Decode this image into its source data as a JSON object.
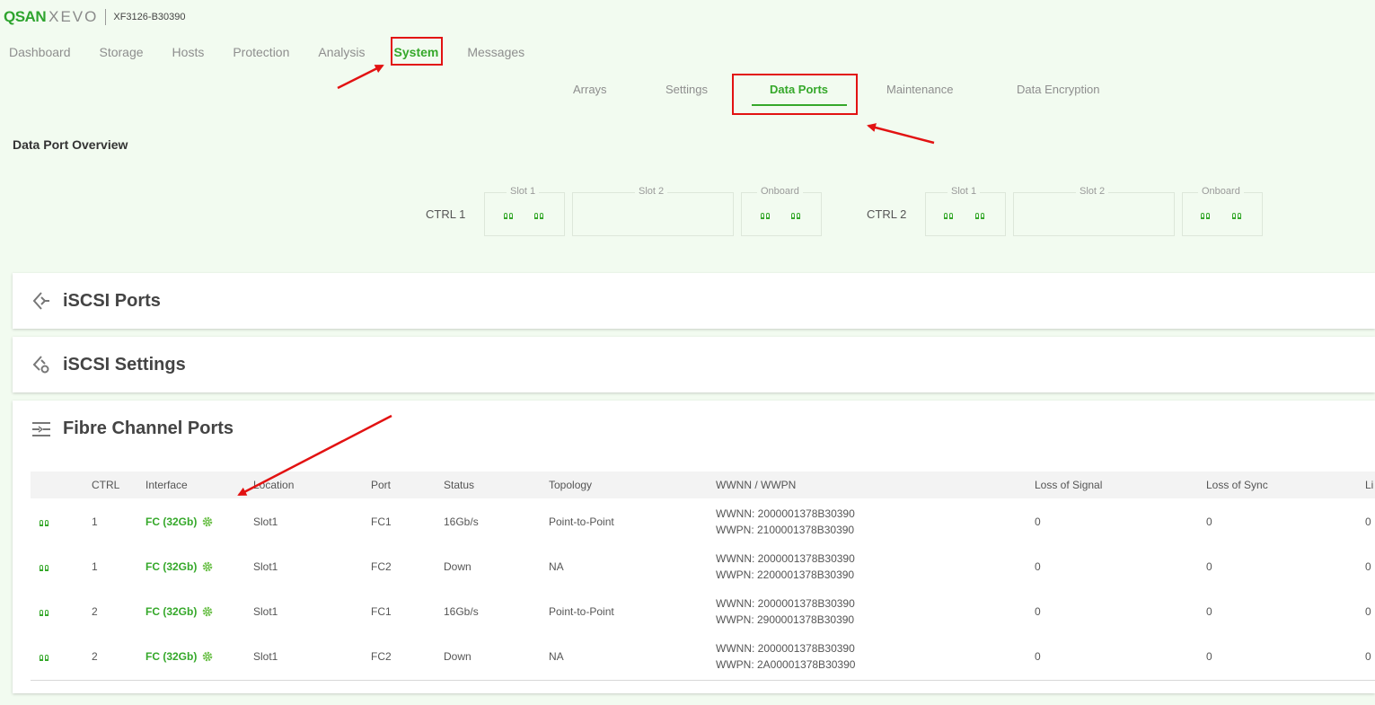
{
  "brand": {
    "logo_a": "QSAN",
    "logo_b": "XEVO",
    "model": "XF3126-B30390"
  },
  "topnav": [
    "Dashboard",
    "Storage",
    "Hosts",
    "Protection",
    "Analysis",
    "System",
    "Messages"
  ],
  "subnav": [
    "Arrays",
    "Settings",
    "Data Ports",
    "Maintenance",
    "Data Encryption"
  ],
  "overview": {
    "title": "Data Port Overview",
    "ctrl1": "CTRL 1",
    "ctrl2": "CTRL 2",
    "slot1": "Slot 1",
    "slot2": "Slot 2",
    "onboard": "Onboard"
  },
  "panels": {
    "iscsi_ports": "iSCSI Ports",
    "iscsi_settings": "iSCSI Settings",
    "fc_ports": "Fibre Channel Ports"
  },
  "table": {
    "headers": [
      "CTRL",
      "Interface",
      "Location",
      "Port",
      "Status",
      "Topology",
      "WWNN / WWPN",
      "Loss of Signal",
      "Loss of Sync",
      "Li"
    ],
    "rows": [
      {
        "ctrl": "1",
        "iface": "FC (32Gb)",
        "loc": "Slot1",
        "port": "FC1",
        "status": "16Gb/s",
        "topo": "Point-to-Point",
        "wwnn": "WWNN: 2000001378B30390",
        "wwpn": "WWPN: 2100001378B30390",
        "los": "0",
        "lsync": "0",
        "li": "0"
      },
      {
        "ctrl": "1",
        "iface": "FC (32Gb)",
        "loc": "Slot1",
        "port": "FC2",
        "status": "Down",
        "topo": "NA",
        "wwnn": "WWNN: 2000001378B30390",
        "wwpn": "WWPN: 2200001378B30390",
        "los": "0",
        "lsync": "0",
        "li": "0"
      },
      {
        "ctrl": "2",
        "iface": "FC (32Gb)",
        "loc": "Slot1",
        "port": "FC1",
        "status": "16Gb/s",
        "topo": "Point-to-Point",
        "wwnn": "WWNN: 2000001378B30390",
        "wwpn": "WWPN: 2900001378B30390",
        "los": "0",
        "lsync": "0",
        "li": "0"
      },
      {
        "ctrl": "2",
        "iface": "FC (32Gb)",
        "loc": "Slot1",
        "port": "FC2",
        "status": "Down",
        "topo": "NA",
        "wwnn": "WWNN: 2000001378B30390",
        "wwpn": "WWPN: 2A00001378B30390",
        "los": "0",
        "lsync": "0",
        "li": "0"
      }
    ]
  },
  "colors": {
    "accent": "#35a82a",
    "highlight": "#e21212",
    "background": "#f2fbf0"
  }
}
